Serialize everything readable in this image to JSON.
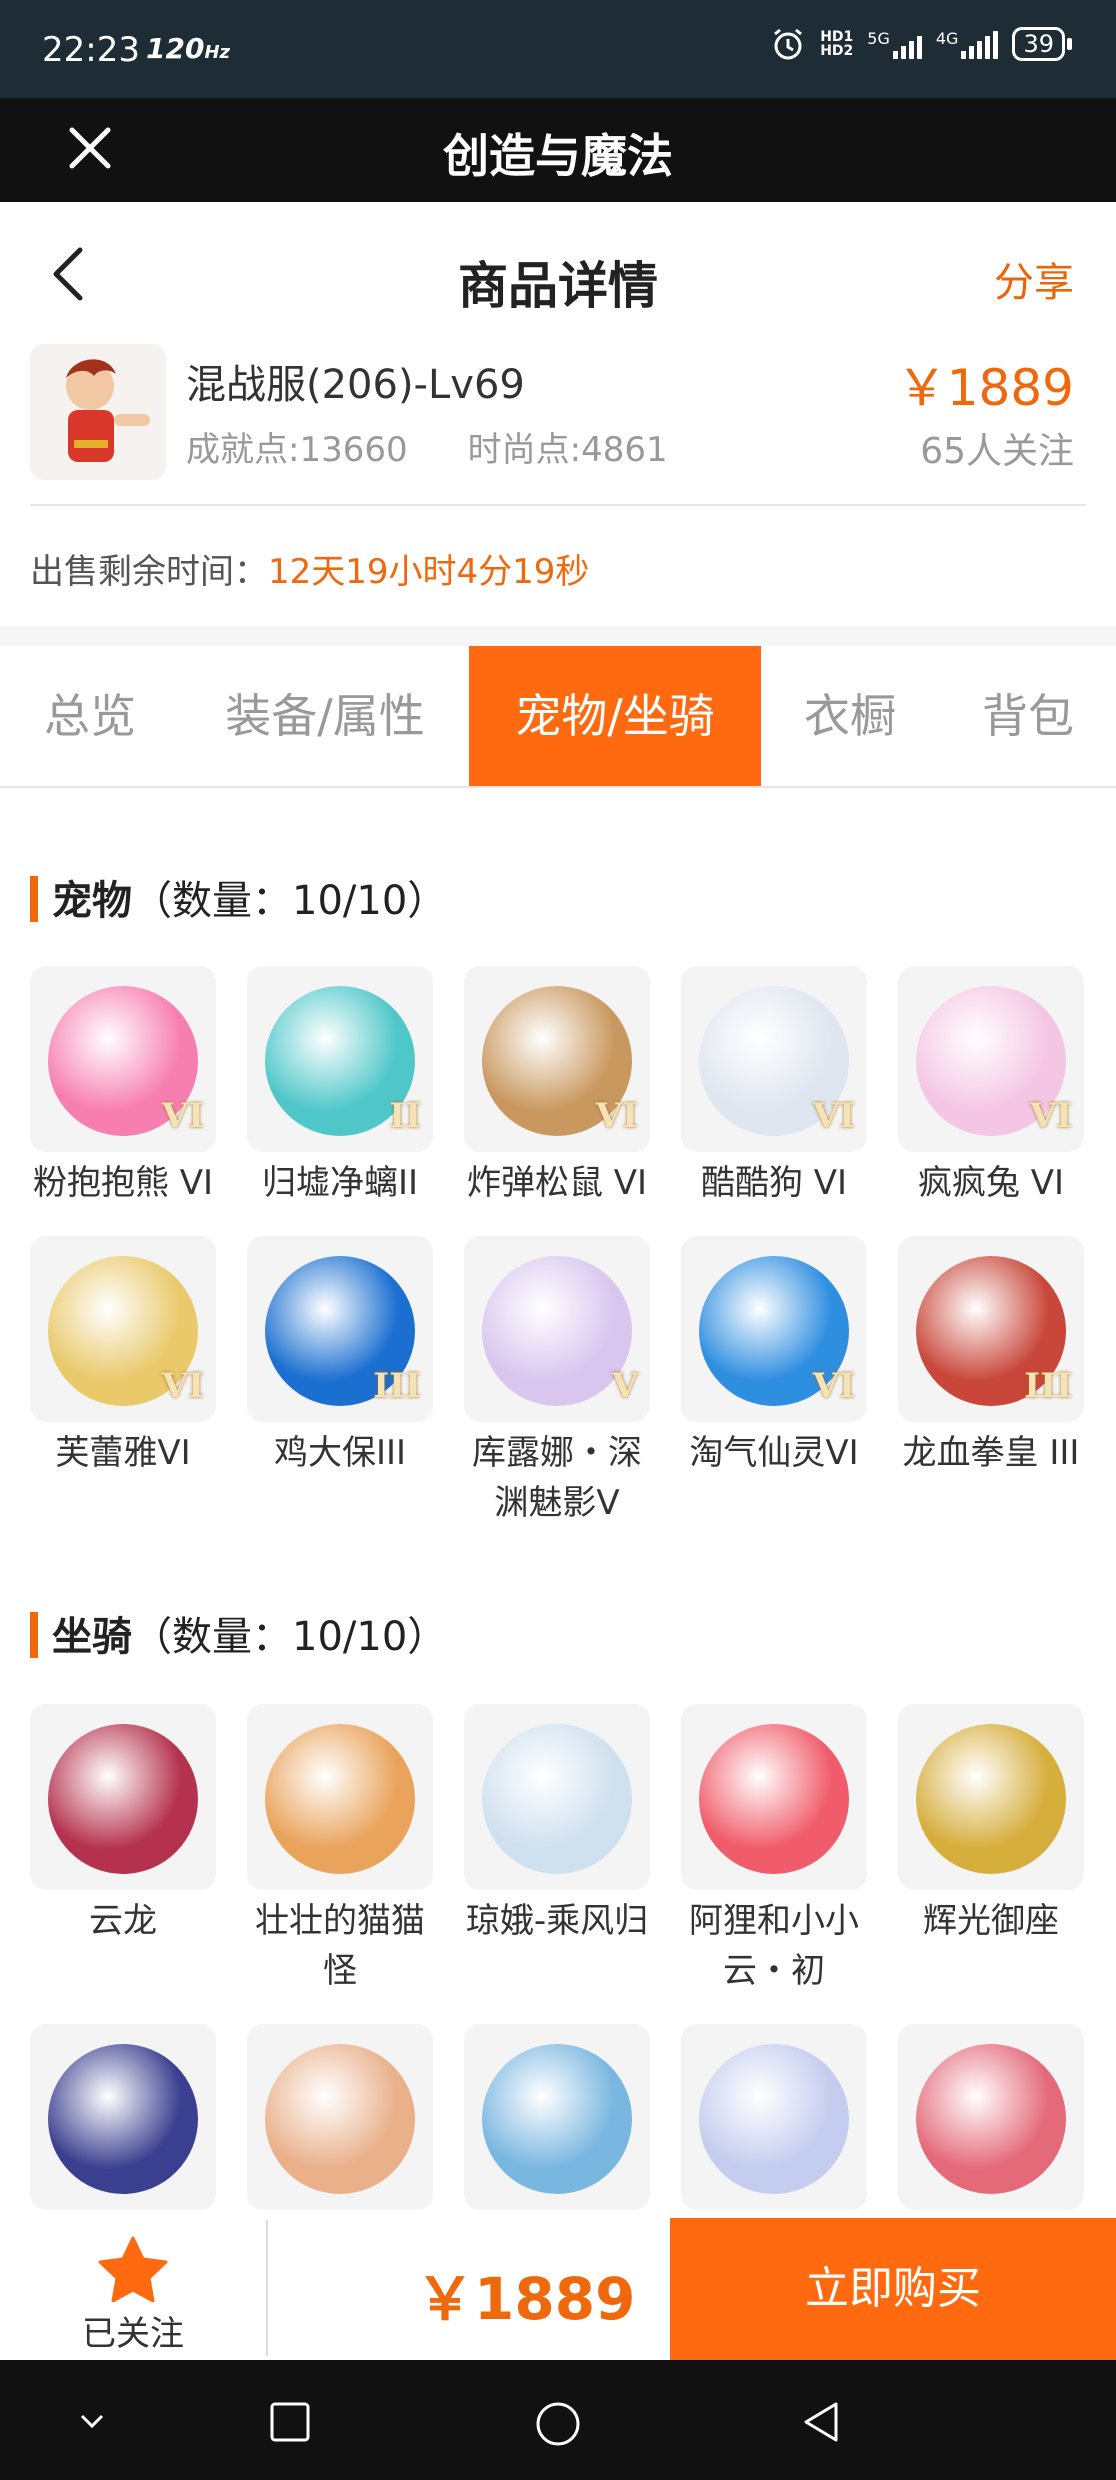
{
  "status": {
    "time": "22:23",
    "refresh": "120",
    "battery": "39"
  },
  "app": {
    "title": "创造与魔法"
  },
  "header": {
    "title": "商品详情",
    "share": "分享"
  },
  "product": {
    "name": "混战服(206)-Lv69",
    "achievement": "成就点:13660",
    "fashion": "时尚点:4861",
    "price": "￥1889",
    "followers": "65人关注"
  },
  "timer": {
    "label": "出售剩余时间：",
    "value": "12天19小时4分19秒"
  },
  "tabs": [
    {
      "label": "总览"
    },
    {
      "label": "装备/属性"
    },
    {
      "label": "宠物/坐骑",
      "active": true
    },
    {
      "label": "衣橱"
    },
    {
      "label": "背包"
    }
  ],
  "pets": {
    "title": "宠物",
    "count": "（数量：10/10）",
    "items": [
      {
        "label": "粉抱抱熊 VI",
        "roman": "VI",
        "color": "#f77fb0"
      },
      {
        "label": "归墟净螭II",
        "roman": "II",
        "color": "#4fc7c9"
      },
      {
        "label": "炸弹松鼠 VI",
        "roman": "VI",
        "color": "#c9985f"
      },
      {
        "label": "酷酷狗 VI",
        "roman": "VI",
        "color": "#dfe6f0"
      },
      {
        "label": "疯疯兔 VI",
        "roman": "VI",
        "color": "#f4c6e4"
      },
      {
        "label": "芙蕾雅VI",
        "roman": "VI",
        "color": "#e9c96a"
      },
      {
        "label": "鸡大保III",
        "roman": "III",
        "color": "#1a6fd0"
      },
      {
        "label": "库露娜・深渊魅影V",
        "roman": "V",
        "color": "#d8c6ef"
      },
      {
        "label": "淘气仙灵VI",
        "roman": "VI",
        "color": "#2e8ee0"
      },
      {
        "label": "龙血拳皇 III",
        "roman": "III",
        "color": "#c8473a"
      }
    ]
  },
  "mounts": {
    "title": "坐骑",
    "count": "（数量：10/10）",
    "items": [
      {
        "label": "云龙",
        "color": "#b5324e"
      },
      {
        "label": "壮壮的猫猫怪",
        "color": "#e9a35b"
      },
      {
        "label": "琼娥-乘风归",
        "color": "#cfe0ef"
      },
      {
        "label": "阿狸和小小云・初",
        "color": "#f05c6a"
      },
      {
        "label": "辉光御座",
        "color": "#d6ae3c"
      },
      {
        "label": "",
        "color": "#3b3f8f"
      },
      {
        "label": "",
        "color": "#e9b08a"
      },
      {
        "label": "",
        "color": "#79b6e0"
      },
      {
        "label": "",
        "color": "#c4ccef"
      },
      {
        "label": "",
        "color": "#e46a7a"
      }
    ]
  },
  "bottom": {
    "follow_label": "已关注",
    "price": "￥1889",
    "buy_label": "立即购买"
  }
}
